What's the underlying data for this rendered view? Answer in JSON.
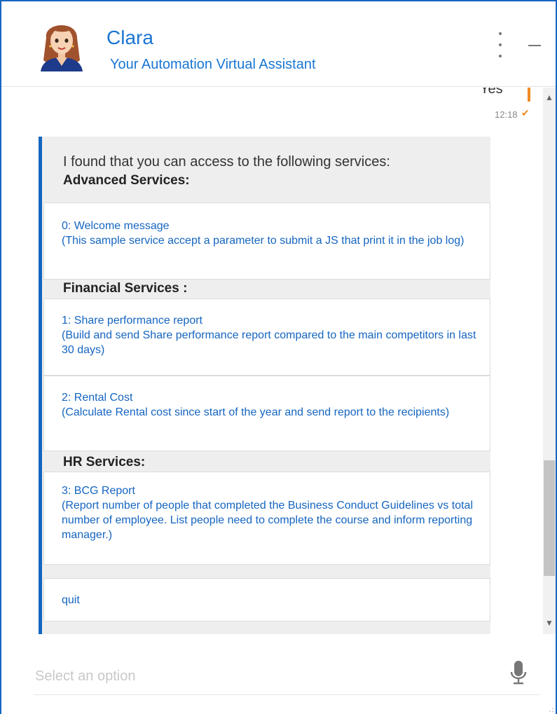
{
  "header": {
    "bot_name": "Clara",
    "bot_subtitle": "Your Automation Virtual Assistant",
    "avatar_icon": "assistant-avatar",
    "menu_icon": "kebab-menu-icon",
    "minimize_icon": "minimize-icon"
  },
  "chat": {
    "user_message": {
      "text": "Yes",
      "time": "12:18",
      "status_icon": "check-icon",
      "accent_color": "#f08a24"
    },
    "bot_message": {
      "intro": "I found that you can access to the following services:",
      "sections": [
        {
          "title": "Advanced Services:",
          "options": [
            {
              "line1": "0: Welcome message",
              "line2": "(This sample service accept a parameter to submit a JS that print it in the job log)"
            }
          ]
        },
        {
          "title": "Financial Services :",
          "options": [
            {
              "line1": "1: Share performance report",
              "line2": "(Build and send Share performance report compared to the main competitors in last 30 days)"
            },
            {
              "line1": "2: Rental Cost",
              "line2": "(Calculate Rental cost since start of the year and send report to the recipients)"
            }
          ]
        },
        {
          "title": "HR Services:",
          "options": [
            {
              "line1": "3: BCG Report",
              "line2": "(Report number of people that completed the Business Conduct Guidelines vs total number of employee. List people need to complete the course and inform reporting manager.)"
            }
          ]
        }
      ],
      "quit_label": "quit",
      "accent_color": "#1565c0"
    }
  },
  "input": {
    "placeholder": "Select an option",
    "mic_icon": "microphone-icon"
  },
  "colors": {
    "brand": "#1976d2",
    "link": "#1565c0",
    "bubble_bg": "#eeeeee"
  }
}
